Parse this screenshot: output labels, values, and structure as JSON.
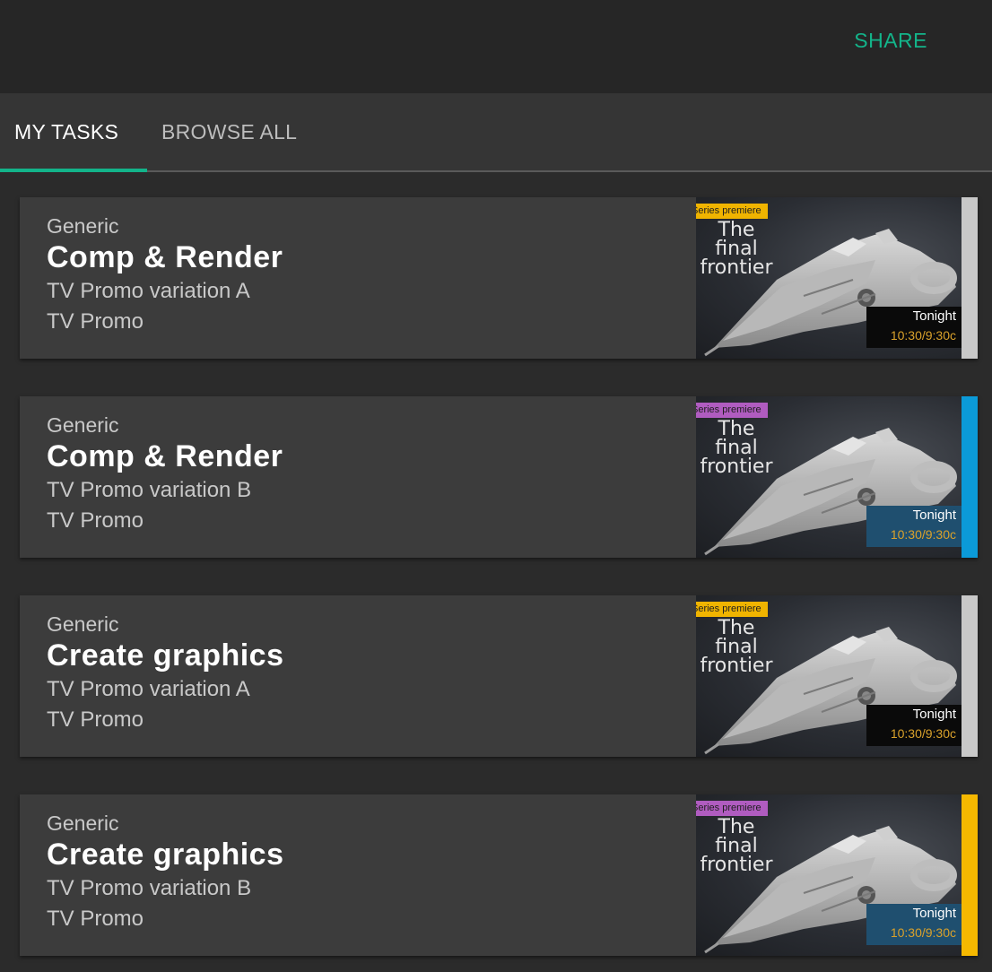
{
  "header": {
    "share_label": "SHARE",
    "share_color": "#13b48a"
  },
  "tabs": [
    {
      "label": "MY TASKS",
      "active": true
    },
    {
      "label": "BROWSE ALL",
      "active": false
    }
  ],
  "tasks": [
    {
      "category": "Generic",
      "title": "Comp & Render",
      "variation": "TV Promo variation A",
      "project": "TV Promo",
      "thumbnail": {
        "badge": "Series premiere",
        "badge_color": "yellow",
        "title_line1": "The final",
        "title_line2": "frontier",
        "day": "Tonight",
        "time": "10:30/9:30c",
        "airtime_style": "dark"
      },
      "edge_color": "#c8c8c8"
    },
    {
      "category": "Generic",
      "title": "Comp & Render",
      "variation": "TV Promo variation B",
      "project": "TV Promo",
      "thumbnail": {
        "badge": "Series premiere",
        "badge_color": "purple",
        "title_line1": "The final",
        "title_line2": "frontier",
        "day": "Tonight",
        "time": "10:30/9:30c",
        "airtime_style": "blue"
      },
      "edge_color": "#0b9ad8"
    },
    {
      "category": "Generic",
      "title": "Create graphics",
      "variation": "TV Promo variation A",
      "project": "TV Promo",
      "thumbnail": {
        "badge": "Series premiere",
        "badge_color": "yellow",
        "title_line1": "The final",
        "title_line2": "frontier",
        "day": "Tonight",
        "time": "10:30/9:30c",
        "airtime_style": "dark"
      },
      "edge_color": "#c8c8c8"
    },
    {
      "category": "Generic",
      "title": "Create graphics",
      "variation": "TV Promo variation B",
      "project": "TV Promo",
      "thumbnail": {
        "badge": "Series premiere",
        "badge_color": "purple",
        "title_line1": "The final",
        "title_line2": "frontier",
        "day": "Tonight",
        "time": "10:30/9:30c",
        "airtime_style": "blue"
      },
      "edge_color": "#f5b800"
    }
  ]
}
